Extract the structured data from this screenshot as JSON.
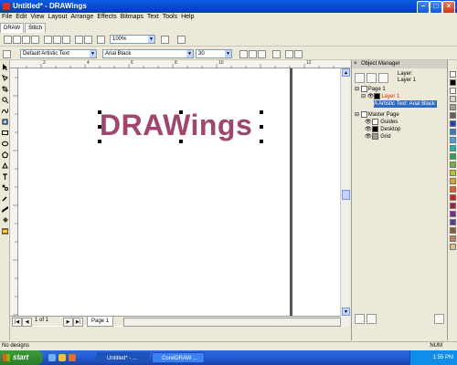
{
  "window": {
    "title": "Untitled* - DRAWings"
  },
  "menu": {
    "items": [
      "File",
      "Edit",
      "View",
      "Layout",
      "Arrange",
      "Effects",
      "Bitmaps",
      "Text",
      "Tools",
      "Help"
    ]
  },
  "tabs": [
    "DRAW",
    "Stitch"
  ],
  "toolbar": {
    "zoom": "100%"
  },
  "property_bar": {
    "style": "Default Artistic Text",
    "font_name": "Arial Black",
    "font_size": "30"
  },
  "rulers": {
    "horizontal_ticks": [
      "2",
      "4",
      "6",
      "8",
      "10",
      "12"
    ]
  },
  "canvas": {
    "text": "DRAWings",
    "text_color": "#a0466e"
  },
  "page_nav": {
    "page_tab": "Page 1",
    "page_counter": "1 of 1"
  },
  "object_manager": {
    "title": "Object Manager",
    "layer_header": [
      "Layer:",
      "Layer 1"
    ],
    "tree": [
      {
        "label": "Page 1",
        "level": 0
      },
      {
        "label": "Layer 1",
        "level": 1,
        "color": "#e02020"
      },
      {
        "label": "Artistic Text: Arial Black",
        "level": 2,
        "selected": true
      },
      {
        "label": "Master Page",
        "level": 0
      },
      {
        "label": "Guides",
        "level": 1
      },
      {
        "label": "Desktop",
        "level": 1
      },
      {
        "label": "Grid",
        "level": 1
      }
    ]
  },
  "palette": [
    "#ffffff",
    "#000000",
    "#ffffff",
    "#d4d4d4",
    "#9c9c9c",
    "#606060",
    "#2040c0",
    "#2a7ad0",
    "#40a0e0",
    "#20b0b0",
    "#30a050",
    "#70b040",
    "#c0c020",
    "#e0a020",
    "#e06020",
    "#d02020",
    "#a02050",
    "#7a2a8a",
    "#5a3a9a",
    "#8a5a3a",
    "#c08060",
    "#e0c080"
  ],
  "status": {
    "left": "No designs",
    "right": "NUM"
  },
  "taskbar": {
    "start": "start",
    "tasks": [
      "Untitled* - ...",
      "CorelDRAW ..."
    ],
    "clock": "1:55 PM"
  }
}
